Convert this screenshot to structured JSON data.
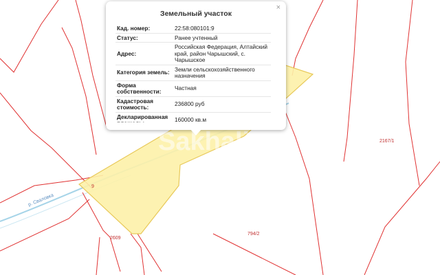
{
  "map": {
    "parcel_labels": {
      "p_2167_1": "2167/1",
      "p_2609": "2609",
      "p_794_2": "794/2",
      "p_9": "9"
    },
    "river_label": "р. Сваловка",
    "watermark": "Sakhalin",
    "colors": {
      "boundary": "#e03232",
      "selected_fill": "#fdf1a8",
      "selected_border": "#e8c95a",
      "river": "#a6d4e8",
      "label": "#c03030",
      "river_label": "#5a8ec0"
    }
  },
  "popup": {
    "title": "Земельный участок",
    "close_label": "×",
    "rows": [
      {
        "label": "Кад. номер:",
        "value": "22:58:080101:9"
      },
      {
        "label": "Статус:",
        "value": "Ранее учтенный"
      },
      {
        "label": "Адрес:",
        "value": "Российская Федерация, Алтайский край, район Чарышский, с. Чарышское"
      },
      {
        "label": "Категория земель:",
        "value": "Земли сельскохозяйственного назначения"
      },
      {
        "label": "Форма собственности:",
        "value": "Частная"
      },
      {
        "label": "Кадастровая стоимость:",
        "value": "236800 руб"
      },
      {
        "label": "Декларированная площадь:",
        "value": "160000 кв.м"
      }
    ]
  }
}
